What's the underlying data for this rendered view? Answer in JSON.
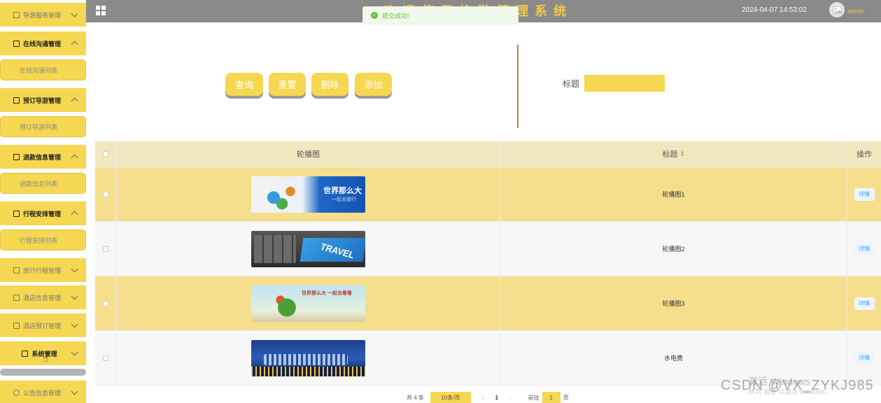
{
  "header": {
    "title": "欢迎使用旅游管理系统",
    "datetime": "2024-04-07 14:53:02",
    "username": "admin"
  },
  "toast": {
    "message": "提交成功!"
  },
  "sidebar": {
    "items": [
      {
        "label": "导游服务管理",
        "expanded": false
      },
      {
        "label": "在线沟通管理",
        "expanded": true,
        "sub": "在线沟通列表"
      },
      {
        "label": "预订导游管理",
        "expanded": true,
        "sub": "预订导游列表"
      },
      {
        "label": "退款信息管理",
        "expanded": true,
        "sub": "退款信息列表"
      },
      {
        "label": "行程安排管理",
        "expanded": true,
        "sub": "行程安排列表"
      },
      {
        "label": "旅行行程管理",
        "expanded": false
      },
      {
        "label": "酒店信息管理",
        "expanded": false
      },
      {
        "label": "酒店预订管理",
        "expanded": false
      },
      {
        "label": "系统管理",
        "expanded": false
      },
      {
        "label": "公告信息管理",
        "expanded": false
      }
    ]
  },
  "toolbar": {
    "query": "查询",
    "reset": "重置",
    "delete": "删除",
    "add": "添加"
  },
  "search": {
    "title_label": "标题",
    "title_value": ""
  },
  "table": {
    "headers": {
      "image": "轮播图",
      "title": "标题",
      "action": "操作"
    },
    "rows": [
      {
        "title": "轮播图1",
        "action": "详情",
        "banner": "世界那么大",
        "banner_sub": "一起去旅行"
      },
      {
        "title": "轮播图2",
        "action": "详情",
        "banner": "TRAVEL"
      },
      {
        "title": "轮播图3",
        "action": "详情",
        "banner": "世界那么大 一起去看看"
      },
      {
        "title": "水电费",
        "action": "详情"
      }
    ]
  },
  "pagination": {
    "total": "共 4 条",
    "page_size": "10条/页",
    "prev": "‹",
    "current": "1",
    "next": "›",
    "goto_label": "前往",
    "goto_value": "1",
    "goto_suffix": "页"
  },
  "overlay": {
    "activate_windows": "激活 Windows",
    "activate_hint": "转到\"设置\"以激活 Windows。",
    "csdn": "CSDN @VX_ZYKJ985"
  },
  "colors": {
    "accent": "#f5d751",
    "topbar": "#8a8a8a",
    "title": "#f3c74a",
    "success": "#67c23a"
  }
}
